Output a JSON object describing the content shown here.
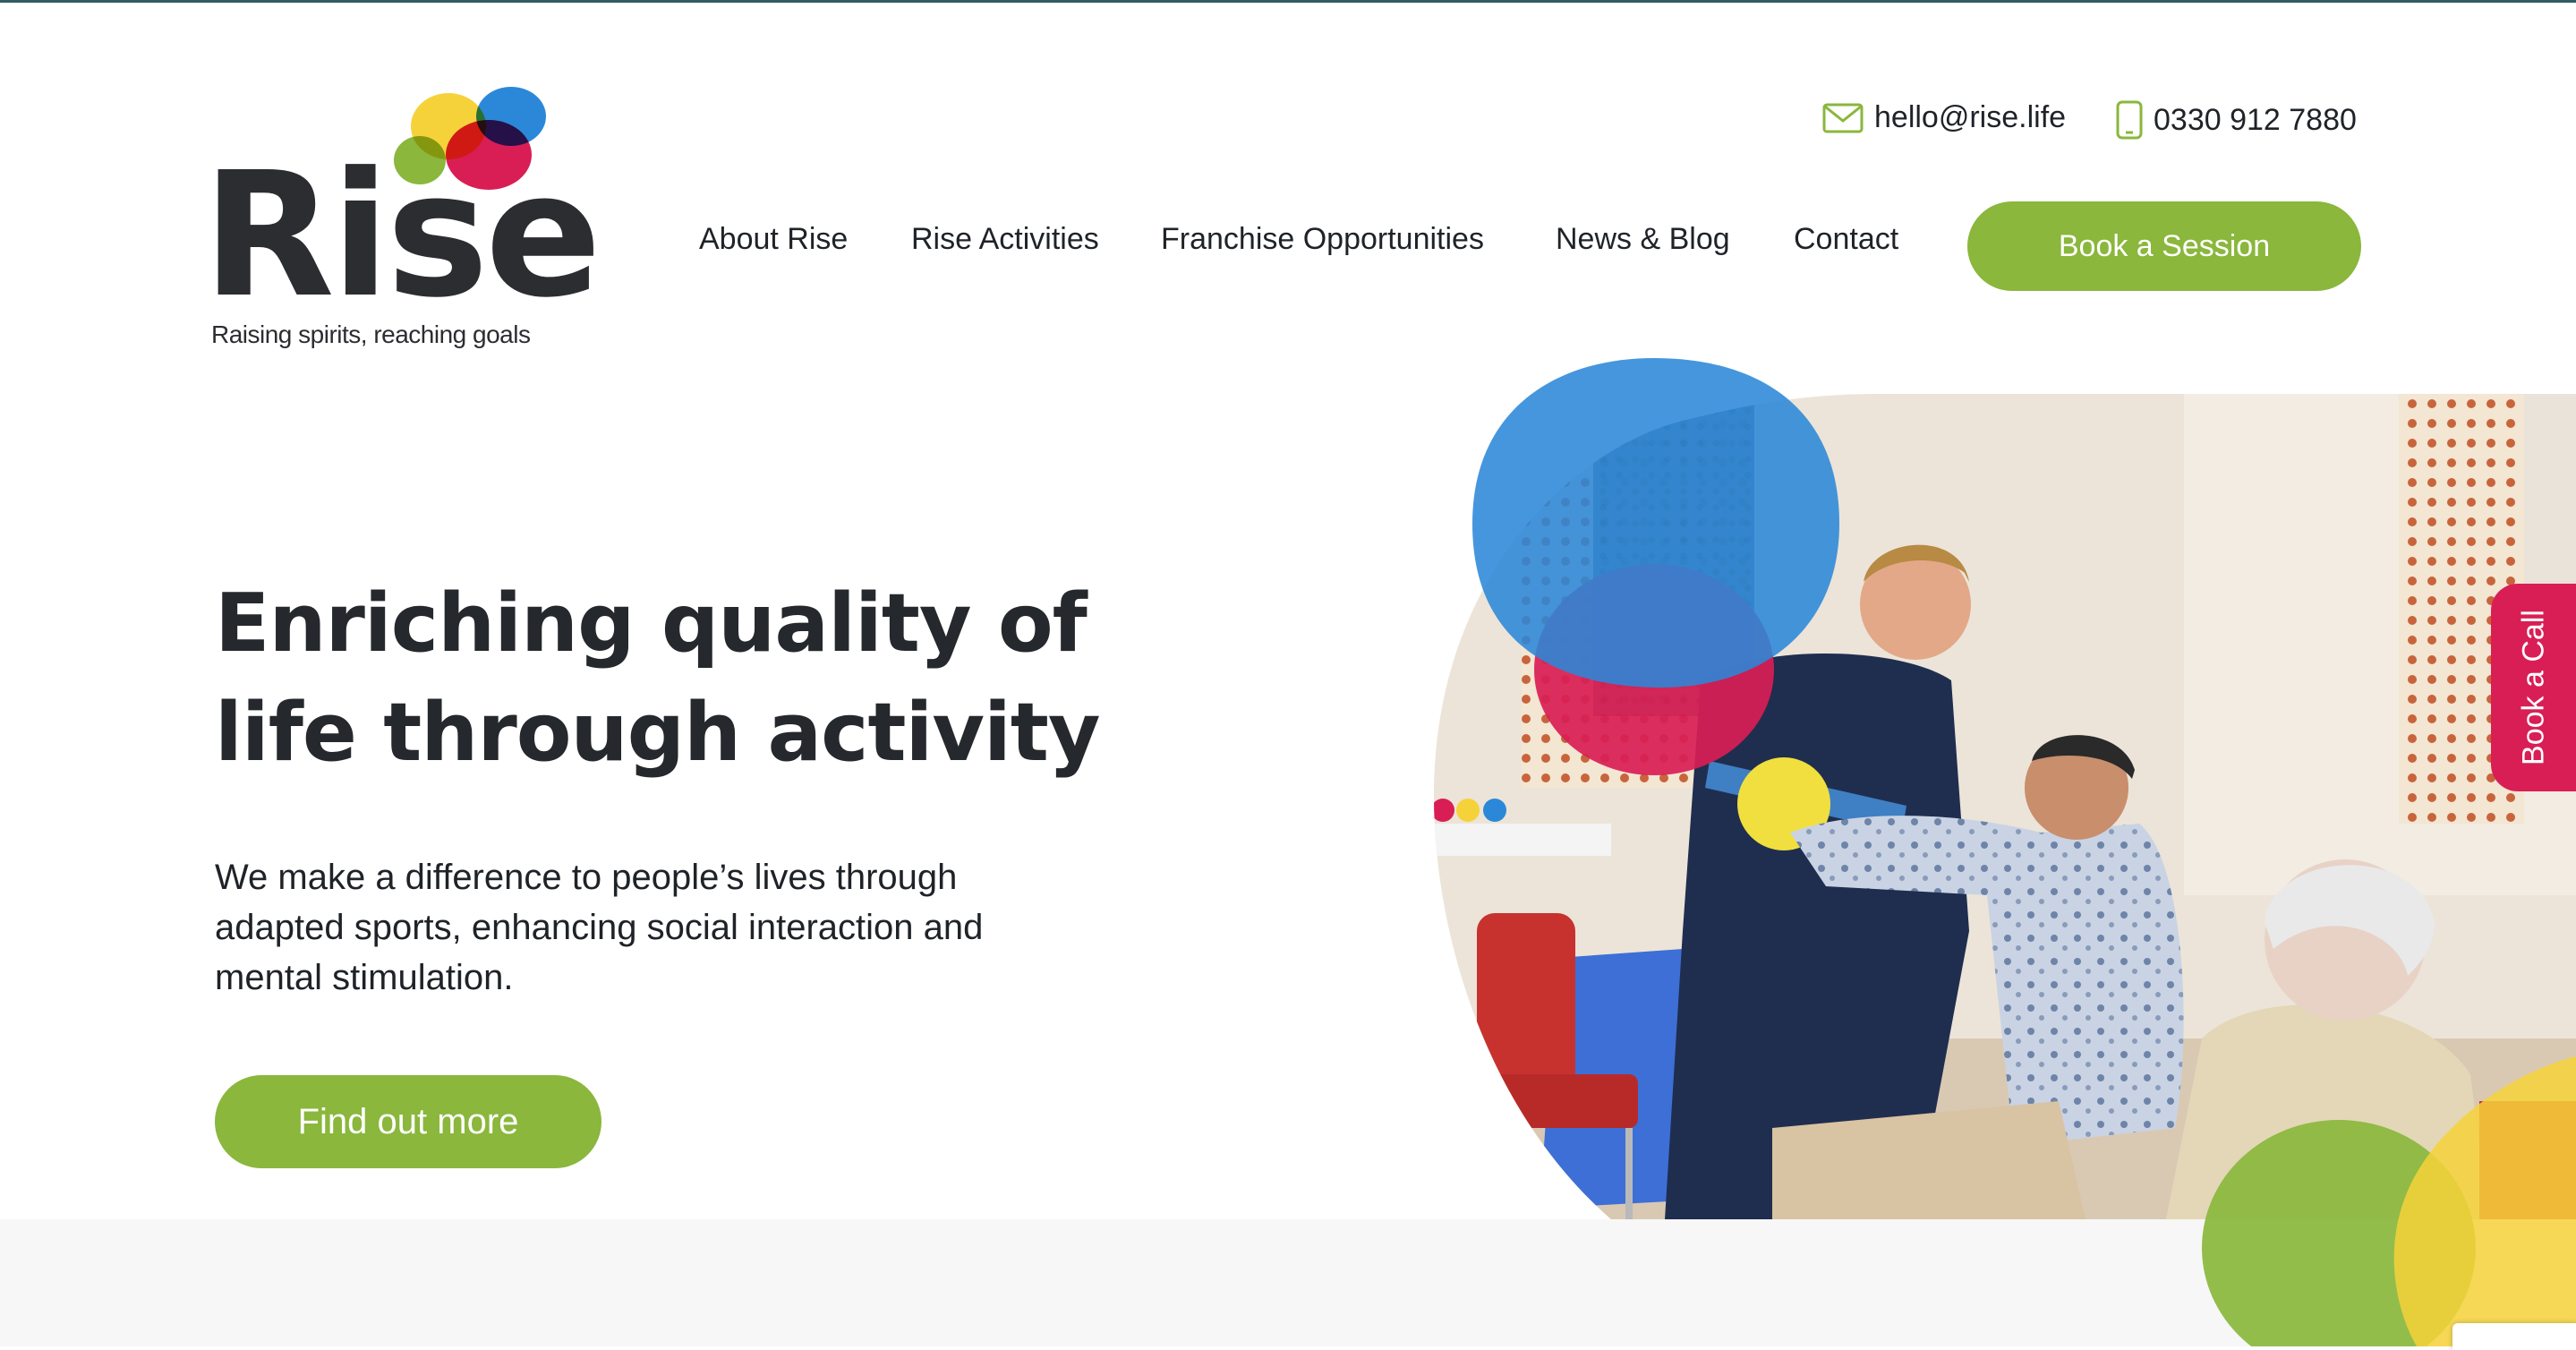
{
  "brand": {
    "name": "Rise",
    "tagline": "Raising spirits, reaching goals",
    "colors": {
      "green": "#8ab73c",
      "red": "#d91e55",
      "blue": "#2b88d8",
      "yellow": "#f6d23a",
      "dark": "#25282c"
    }
  },
  "contact": {
    "email": "hello@rise.life",
    "email_icon": "envelope-icon",
    "phone": "0330 912 7880",
    "phone_icon": "mobile-phone-icon"
  },
  "nav": {
    "items": [
      {
        "label": "About Rise"
      },
      {
        "label": "Rise Activities"
      },
      {
        "label": "Franchise Opportunities"
      },
      {
        "label": "News & Blog"
      },
      {
        "label": "Contact"
      }
    ],
    "cta_label": "Book a Session"
  },
  "hero": {
    "title_line1": "Enriching quality of",
    "title_line2": "life through activity",
    "subtitle": "We make a difference to people’s lives through adapted sports, enhancing social interaction and mental stimulation.",
    "cta_label": "Find out more",
    "image_alt": "Rise instructor with adults doing a seated ball activity"
  },
  "side_tab": {
    "label": "Book a Call"
  }
}
